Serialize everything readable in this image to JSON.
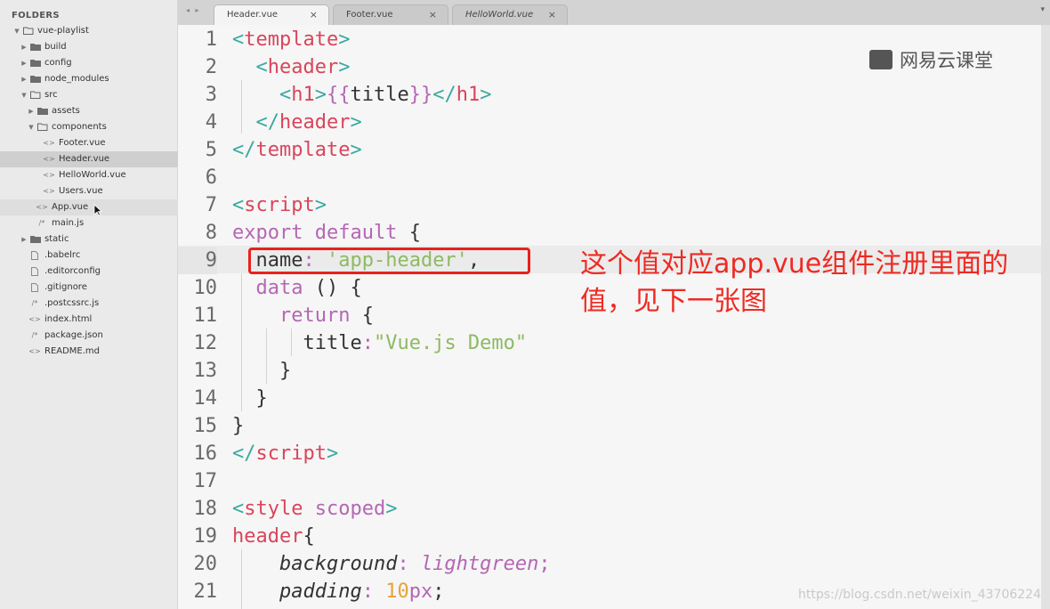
{
  "sidebar": {
    "title": "FOLDERS",
    "items": [
      {
        "label": "vue-playlist",
        "type": "folder",
        "open": true,
        "depth": 0
      },
      {
        "label": "build",
        "type": "folder",
        "open": false,
        "depth": 1
      },
      {
        "label": "config",
        "type": "folder",
        "open": false,
        "depth": 1
      },
      {
        "label": "node_modules",
        "type": "folder",
        "open": false,
        "depth": 1
      },
      {
        "label": "src",
        "type": "folder",
        "open": true,
        "depth": 1
      },
      {
        "label": "assets",
        "type": "folder",
        "open": false,
        "depth": 2
      },
      {
        "label": "components",
        "type": "folder",
        "open": true,
        "depth": 2
      },
      {
        "label": "Footer.vue",
        "type": "file",
        "glyph": "<>",
        "depth": 3
      },
      {
        "label": "Header.vue",
        "type": "file",
        "glyph": "<>",
        "depth": 3,
        "selected": true
      },
      {
        "label": "HelloWorld.vue",
        "type": "file",
        "glyph": "<>",
        "depth": 3
      },
      {
        "label": "Users.vue",
        "type": "file",
        "glyph": "<>",
        "depth": 3
      },
      {
        "label": "App.vue",
        "type": "file",
        "glyph": "<>",
        "depth": 2,
        "hover": true
      },
      {
        "label": "main.js",
        "type": "file",
        "glyph": "/*",
        "depth": 2
      },
      {
        "label": "static",
        "type": "folder",
        "open": false,
        "depth": 1
      },
      {
        "label": ".babelrc",
        "type": "file",
        "glyph": "doc",
        "depth": 1
      },
      {
        "label": ".editorconfig",
        "type": "file",
        "glyph": "doc",
        "depth": 1
      },
      {
        "label": ".gitignore",
        "type": "file",
        "glyph": "doc",
        "depth": 1
      },
      {
        "label": ".postcssrc.js",
        "type": "file",
        "glyph": "/*",
        "depth": 1
      },
      {
        "label": "index.html",
        "type": "file",
        "glyph": "<>",
        "depth": 1
      },
      {
        "label": "package.json",
        "type": "file",
        "glyph": "/*",
        "depth": 1
      },
      {
        "label": "README.md",
        "type": "file",
        "glyph": "<>",
        "depth": 1
      }
    ]
  },
  "tabs": [
    {
      "label": "Header.vue",
      "active": true,
      "close": "×"
    },
    {
      "label": "Footer.vue",
      "active": false,
      "close": "×"
    },
    {
      "label": "HelloWorld.vue",
      "active": false,
      "close": "×",
      "italic": true
    }
  ],
  "nav_arrows": "◂ ▸",
  "tab_dropdown": "▾",
  "editor": {
    "current_line": 9,
    "lines": [
      {
        "n": "1",
        "tokens": [
          [
            "t-pun",
            "<"
          ],
          [
            "t-tag",
            "template"
          ],
          [
            "t-pun",
            ">"
          ]
        ],
        "indent": 0
      },
      {
        "n": "2",
        "tokens": [
          [
            "t-pun",
            "<"
          ],
          [
            "t-tag",
            "header"
          ],
          [
            "t-pun",
            ">"
          ]
        ],
        "indent": 1
      },
      {
        "n": "3",
        "tokens": [
          [
            "t-pun",
            "<"
          ],
          [
            "t-tag",
            "h1"
          ],
          [
            "t-pun",
            ">"
          ],
          [
            "t-kw",
            "{{"
          ],
          [
            "",
            "title"
          ],
          [
            "t-kw",
            "}}"
          ],
          [
            "t-pun",
            "</"
          ],
          [
            "t-tag",
            "h1"
          ],
          [
            "t-pun",
            ">"
          ]
        ],
        "indent": 2
      },
      {
        "n": "4",
        "tokens": [
          [
            "t-pun",
            "</"
          ],
          [
            "t-tag",
            "header"
          ],
          [
            "t-pun",
            ">"
          ]
        ],
        "indent": 1
      },
      {
        "n": "5",
        "tokens": [
          [
            "t-pun",
            "</"
          ],
          [
            "t-tag",
            "template"
          ],
          [
            "t-pun",
            ">"
          ]
        ],
        "indent": 0
      },
      {
        "n": "6",
        "tokens": [],
        "indent": 0
      },
      {
        "n": "7",
        "tokens": [
          [
            "t-pun",
            "<"
          ],
          [
            "t-tag",
            "script"
          ],
          [
            "t-pun",
            ">"
          ]
        ],
        "indent": 0
      },
      {
        "n": "8",
        "tokens": [
          [
            "t-kw",
            "export default "
          ],
          [
            "",
            "{"
          ]
        ],
        "indent": 0
      },
      {
        "n": "9",
        "tokens": [
          [
            "",
            "name"
          ],
          [
            "t-kw",
            ": "
          ],
          [
            "t-str",
            "'app-header'"
          ],
          [
            "",
            ","
          ]
        ],
        "indent": 1
      },
      {
        "n": "10",
        "tokens": [
          [
            "t-kw",
            "data "
          ],
          [
            "",
            "() {"
          ]
        ],
        "indent": 1
      },
      {
        "n": "11",
        "tokens": [
          [
            "t-kw",
            "return "
          ],
          [
            "",
            "{"
          ]
        ],
        "indent": 2
      },
      {
        "n": "12",
        "tokens": [
          [
            "",
            "title"
          ],
          [
            "t-kw",
            ":"
          ],
          [
            "t-str",
            "\"Vue.js Demo\""
          ]
        ],
        "indent": 3
      },
      {
        "n": "13",
        "tokens": [
          [
            "",
            "}"
          ]
        ],
        "indent": 2
      },
      {
        "n": "14",
        "tokens": [
          [
            "",
            "}"
          ]
        ],
        "indent": 1
      },
      {
        "n": "15",
        "tokens": [
          [
            "",
            "}"
          ]
        ],
        "indent": 0
      },
      {
        "n": "16",
        "tokens": [
          [
            "t-pun",
            "</"
          ],
          [
            "t-tag",
            "script"
          ],
          [
            "t-pun",
            ">"
          ]
        ],
        "indent": 0
      },
      {
        "n": "17",
        "tokens": [],
        "indent": 0
      },
      {
        "n": "18",
        "tokens": [
          [
            "t-pun",
            "<"
          ],
          [
            "t-tag",
            "style "
          ],
          [
            "t-kw",
            "scoped"
          ],
          [
            "t-pun",
            ">"
          ]
        ],
        "indent": 0
      },
      {
        "n": "19",
        "tokens": [
          [
            "t-tag",
            "header"
          ],
          [
            "",
            "{"
          ]
        ],
        "indent": 0
      },
      {
        "n": "20",
        "tokens": [
          [
            "t-it",
            "background"
          ],
          [
            "t-kw",
            ": "
          ],
          [
            "t-kw t-it",
            "lightgreen"
          ],
          [
            "t-kw",
            ";"
          ]
        ],
        "indent": 2
      },
      {
        "n": "21",
        "tokens": [
          [
            "t-it",
            "padding"
          ],
          [
            "t-kw",
            ": "
          ],
          [
            "t-num",
            "10"
          ],
          [
            "t-kw",
            "px"
          ],
          [
            "",
            ";"
          ]
        ],
        "indent": 2
      }
    ]
  },
  "annotation": "这个值对应app.vue组件注册里面的值，见下一张图",
  "watermark": {
    "text": "网易云课堂"
  },
  "footer_watermark": "https://blog.csdn.net/weixin_43706224",
  "colors": {
    "highlight": "#e8221c",
    "annotation": "#ee2a22",
    "tag": "#d9455b",
    "keyword": "#b467b3",
    "string": "#8dba62"
  }
}
